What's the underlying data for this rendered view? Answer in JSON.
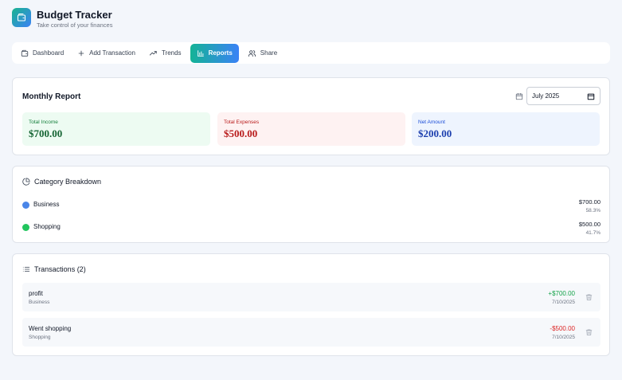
{
  "app": {
    "title": "Budget Tracker",
    "subtitle": "Take control of your finances"
  },
  "nav": {
    "items": [
      {
        "label": "Dashboard",
        "icon": "wallet-icon",
        "active": false
      },
      {
        "label": "Add Transaction",
        "icon": "plus-icon",
        "active": false
      },
      {
        "label": "Trends",
        "icon": "trending-up-icon",
        "active": false
      },
      {
        "label": "Reports",
        "icon": "bar-chart-icon",
        "active": true
      },
      {
        "label": "Share",
        "icon": "users-icon",
        "active": false
      }
    ]
  },
  "report": {
    "title": "Monthly Report",
    "month_value": "July 2025",
    "income": {
      "label": "Total Income",
      "value": "$700.00"
    },
    "expenses": {
      "label": "Total Expenses",
      "value": "$500.00"
    },
    "net": {
      "label": "Net Amount",
      "value": "$200.00"
    }
  },
  "categories": {
    "title": "Category Breakdown",
    "items": [
      {
        "name": "Business",
        "amount": "$700.00",
        "percent": "58.3%",
        "color": "#4a86e8"
      },
      {
        "name": "Shopping",
        "amount": "$500.00",
        "percent": "41.7%",
        "color": "#22c55e"
      }
    ]
  },
  "transactions": {
    "title": "Transactions (2)",
    "items": [
      {
        "description": "profit",
        "category": "Business",
        "amount": "+$700.00",
        "date": "7/10/2025",
        "type": "income"
      },
      {
        "description": "Went shopping",
        "category": "Shopping",
        "amount": "-$500.00",
        "date": "7/10/2025",
        "type": "expense"
      }
    ]
  },
  "colors": {
    "accent_start": "#14b396",
    "accent_end": "#3b82f6",
    "income": "#16a34a",
    "expense": "#dc2626"
  }
}
